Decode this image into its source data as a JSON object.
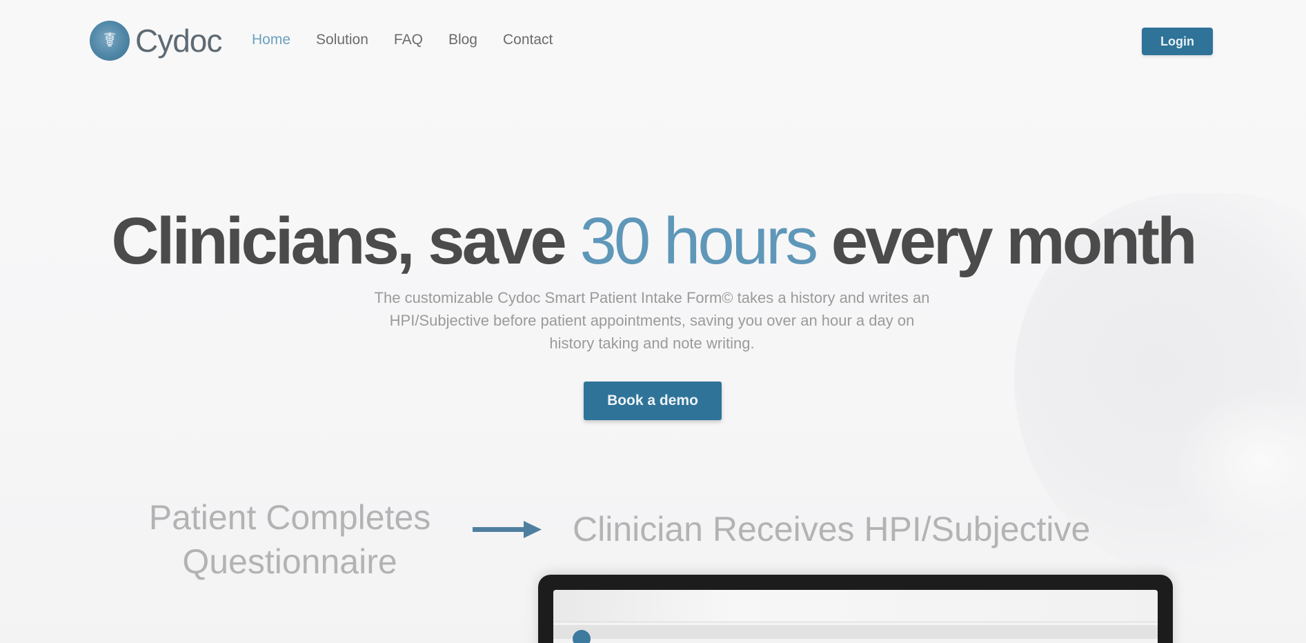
{
  "brand": {
    "name": "Cydoc",
    "accent_color": "#2f7398"
  },
  "nav": {
    "items": [
      {
        "label": "Home",
        "active": true
      },
      {
        "label": "Solution",
        "active": false
      },
      {
        "label": "FAQ",
        "active": false
      },
      {
        "label": "Blog",
        "active": false
      },
      {
        "label": "Contact",
        "active": false
      }
    ],
    "login_label": "Login"
  },
  "hero": {
    "headline_pre": "Clinicians, save ",
    "headline_accent": "30 hours",
    "headline_post": " every month",
    "subtext": "The customizable Cydoc Smart Patient Intake Form© takes a history and writes an HPI/Subjective before patient appointments, saving you over an hour a day on history taking and note writing.",
    "cta_label": "Book a demo"
  },
  "steps": {
    "left": "Patient Completes Questionnaire",
    "right": "Clinician Receives HPI/Subjective"
  }
}
